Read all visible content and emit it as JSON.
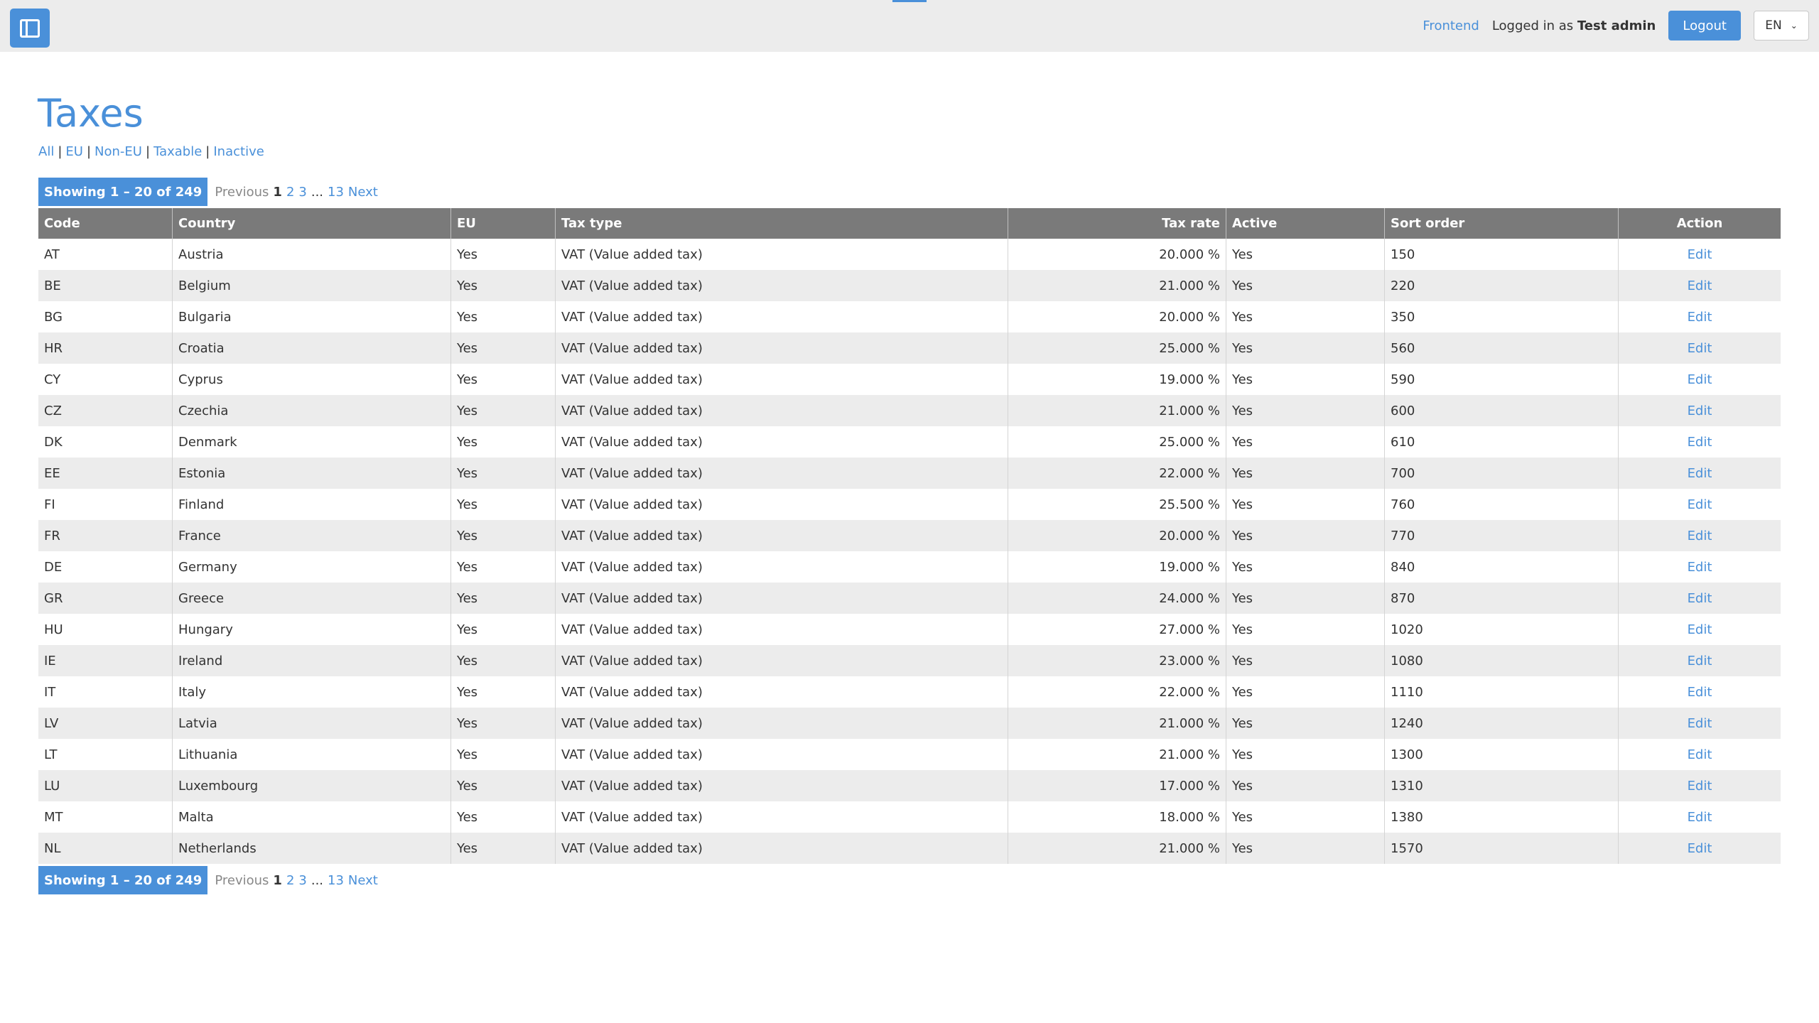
{
  "topbar": {
    "frontend": "Frontend",
    "logged_prefix": "Logged in as",
    "user": "Test admin",
    "logout": "Logout",
    "lang": "EN"
  },
  "page": {
    "title": "Taxes",
    "filters": [
      "All",
      "EU",
      "Non-EU",
      "Taxable",
      "Inactive"
    ]
  },
  "pagination": {
    "showing": "Showing 1 – 20 of 249",
    "previous": "Previous",
    "current": "1",
    "pages": [
      "2",
      "3"
    ],
    "dots": "...",
    "last": "13",
    "next": "Next"
  },
  "table": {
    "headers": [
      "Code",
      "Country",
      "EU",
      "Tax type",
      "Tax rate",
      "Active",
      "Sort order",
      "Action"
    ],
    "rows": [
      [
        "AT",
        "Austria",
        "Yes",
        "VAT (Value added tax)",
        "20.000 %",
        "Yes",
        "150",
        "Edit"
      ],
      [
        "BE",
        "Belgium",
        "Yes",
        "VAT (Value added tax)",
        "21.000 %",
        "Yes",
        "220",
        "Edit"
      ],
      [
        "BG",
        "Bulgaria",
        "Yes",
        "VAT (Value added tax)",
        "20.000 %",
        "Yes",
        "350",
        "Edit"
      ],
      [
        "HR",
        "Croatia",
        "Yes",
        "VAT (Value added tax)",
        "25.000 %",
        "Yes",
        "560",
        "Edit"
      ],
      [
        "CY",
        "Cyprus",
        "Yes",
        "VAT (Value added tax)",
        "19.000 %",
        "Yes",
        "590",
        "Edit"
      ],
      [
        "CZ",
        "Czechia",
        "Yes",
        "VAT (Value added tax)",
        "21.000 %",
        "Yes",
        "600",
        "Edit"
      ],
      [
        "DK",
        "Denmark",
        "Yes",
        "VAT (Value added tax)",
        "25.000 %",
        "Yes",
        "610",
        "Edit"
      ],
      [
        "EE",
        "Estonia",
        "Yes",
        "VAT (Value added tax)",
        "22.000 %",
        "Yes",
        "700",
        "Edit"
      ],
      [
        "FI",
        "Finland",
        "Yes",
        "VAT (Value added tax)",
        "25.500 %",
        "Yes",
        "760",
        "Edit"
      ],
      [
        "FR",
        "France",
        "Yes",
        "VAT (Value added tax)",
        "20.000 %",
        "Yes",
        "770",
        "Edit"
      ],
      [
        "DE",
        "Germany",
        "Yes",
        "VAT (Value added tax)",
        "19.000 %",
        "Yes",
        "840",
        "Edit"
      ],
      [
        "GR",
        "Greece",
        "Yes",
        "VAT (Value added tax)",
        "24.000 %",
        "Yes",
        "870",
        "Edit"
      ],
      [
        "HU",
        "Hungary",
        "Yes",
        "VAT (Value added tax)",
        "27.000 %",
        "Yes",
        "1020",
        "Edit"
      ],
      [
        "IE",
        "Ireland",
        "Yes",
        "VAT (Value added tax)",
        "23.000 %",
        "Yes",
        "1080",
        "Edit"
      ],
      [
        "IT",
        "Italy",
        "Yes",
        "VAT (Value added tax)",
        "22.000 %",
        "Yes",
        "1110",
        "Edit"
      ],
      [
        "LV",
        "Latvia",
        "Yes",
        "VAT (Value added tax)",
        "21.000 %",
        "Yes",
        "1240",
        "Edit"
      ],
      [
        "LT",
        "Lithuania",
        "Yes",
        "VAT (Value added tax)",
        "21.000 %",
        "Yes",
        "1300",
        "Edit"
      ],
      [
        "LU",
        "Luxembourg",
        "Yes",
        "VAT (Value added tax)",
        "17.000 %",
        "Yes",
        "1310",
        "Edit"
      ],
      [
        "MT",
        "Malta",
        "Yes",
        "VAT (Value added tax)",
        "18.000 %",
        "Yes",
        "1380",
        "Edit"
      ],
      [
        "NL",
        "Netherlands",
        "Yes",
        "VAT (Value added tax)",
        "21.000 %",
        "Yes",
        "1570",
        "Edit"
      ]
    ]
  },
  "colors": {
    "accent": "#4a90d9",
    "header_bg": "#7a7a7a",
    "topbar_bg": "#ececec"
  }
}
